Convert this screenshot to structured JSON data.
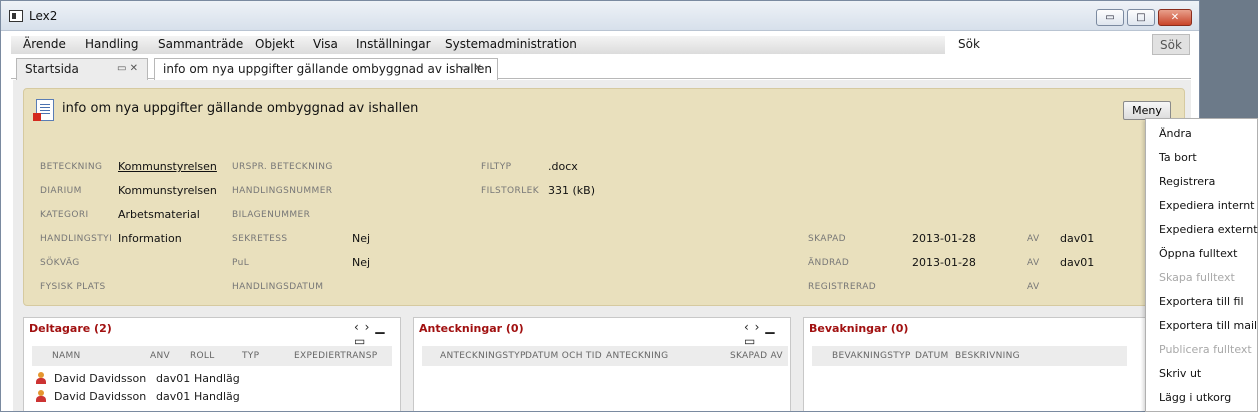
{
  "window": {
    "title": "Lex2",
    "minimize": "▭",
    "maximize": "□",
    "close": "✕"
  },
  "menu": [
    "Ärende",
    "Handling",
    "Sammanträde",
    "Objekt",
    "Visa",
    "Inställningar",
    "Systemadministration"
  ],
  "search": {
    "label": "Sök",
    "value": "",
    "button": "Sök"
  },
  "tabs": [
    {
      "label": "Startsida",
      "controls": "▭ ✕"
    },
    {
      "label": "info om nya uppgifter gällande ombyggnad av ishallen",
      "controls": "▭ ✕"
    }
  ],
  "document": {
    "title": "info om nya uppgifter gällande ombyggnad av ishallen",
    "menu_button": "Meny",
    "fields": {
      "beteckning": {
        "label": "BETECKNING",
        "value": "Kommunstyrelsen"
      },
      "diarium": {
        "label": "DIARIUM",
        "value": "Kommunstyrelsen"
      },
      "kategori": {
        "label": "KATEGORI",
        "value": "Arbetsmaterial"
      },
      "handlingstyp": {
        "label": "HANDLINGSTYI",
        "value": "Information"
      },
      "sokvag": {
        "label": "SÖKVÄG",
        "value": ""
      },
      "fysisk_plats": {
        "label": "FYSISK PLATS",
        "value": ""
      },
      "urspr_beteckning": {
        "label": "URSPR. BETECKNING",
        "value": ""
      },
      "handlingsnummer": {
        "label": "HANDLINGSNUMMER",
        "value": ""
      },
      "bilagenummer": {
        "label": "BILAGENUMMER",
        "value": ""
      },
      "sekretess": {
        "label": "SEKRETESS",
        "value": "Nej"
      },
      "pul": {
        "label": "PuL",
        "value": "Nej"
      },
      "handlingsdatum": {
        "label": "HANDLINGSDATUM",
        "value": ""
      },
      "filtyp": {
        "label": "FILTYP",
        "value": ".docx"
      },
      "filstorlek": {
        "label": "FILSTORLEK",
        "value": "331 (kB)"
      },
      "skapad": {
        "label": "SKAPAD",
        "value": "2013-01-28",
        "av_label": "AV",
        "av": "dav01"
      },
      "andrad": {
        "label": "ÄNDRAD",
        "value": "2013-01-28",
        "av_label": "AV",
        "av": "dav01"
      },
      "registrerad": {
        "label": "REGISTRERAD",
        "value": "",
        "av_label": "AV",
        "av": ""
      }
    }
  },
  "deltagare": {
    "title": "Deltagare (2)",
    "controls": "‹ › ▁ ▭",
    "columns": [
      "NAMN",
      "ANV",
      "ROLL",
      "TYP",
      "EXPEDIERTRANSP"
    ],
    "rows": [
      [
        "David Davidsson",
        "dav01",
        "Handläggare",
        "",
        ""
      ],
      [
        "David Davidsson",
        "dav01",
        "Handläggare",
        "",
        ""
      ]
    ]
  },
  "anteckningar": {
    "title": "Anteckningar (0)",
    "controls": "‹ › ▁ ▭",
    "columns": [
      "ANTECKNINGSTYP",
      "DATUM OCH TID",
      "ANTECKNING",
      "SKAPAD AV"
    ]
  },
  "bevakningar": {
    "title": "Bevakningar (0)",
    "columns": [
      "BEVAKNINGSTYP",
      "DATUM",
      "BESKRIVNING"
    ]
  },
  "dropdown": {
    "items": [
      {
        "label": "Ändra",
        "enabled": true
      },
      {
        "label": "Ta bort",
        "enabled": true
      },
      {
        "label": "Registrera",
        "enabled": true
      },
      {
        "label": "Expediera internt",
        "enabled": true
      },
      {
        "label": "Expediera externt",
        "enabled": true
      },
      {
        "label": "Öppna fulltext",
        "enabled": true
      },
      {
        "label": "Skapa fulltext",
        "enabled": false
      },
      {
        "label": "Exportera till fil",
        "enabled": true
      },
      {
        "label": "Exportera till mail",
        "enabled": true
      },
      {
        "label": "Publicera fulltext",
        "enabled": false
      },
      {
        "label": "Skriv ut",
        "enabled": true
      },
      {
        "label": "Lägg i utkorg",
        "enabled": true
      }
    ]
  }
}
